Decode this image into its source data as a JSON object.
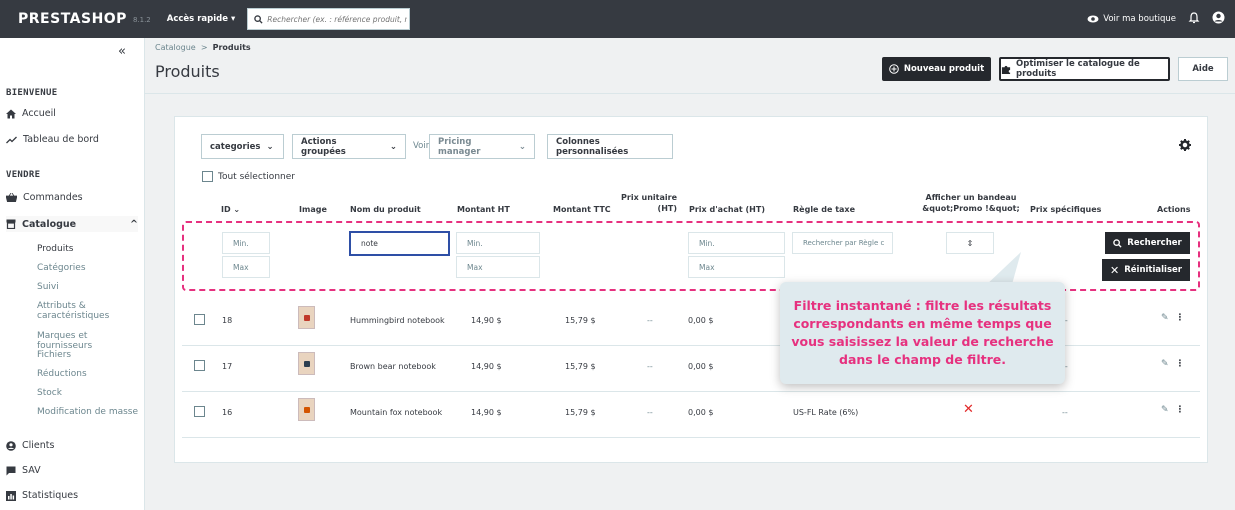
{
  "topbar": {
    "logo": "PRESTASHOP",
    "version": "8.1.2",
    "quick_access": "Accès rapide",
    "search_placeholder": "Rechercher (ex. : référence produit, no",
    "view_shop": "Voir ma boutique"
  },
  "sidebar": {
    "collapse": "«",
    "section_welcome": "BIENVENUE",
    "accueil": "Accueil",
    "dashboard": "Tableau de bord",
    "section_sell": "VENDRE",
    "commandes": "Commandes",
    "catalogue": "Catalogue",
    "sub": {
      "produits": "Produits",
      "categories": "Catégories",
      "suivi": "Suivi",
      "attributs_1": "Attributs &",
      "attributs_2": "caractéristiques",
      "marques": "Marques et fournisseurs",
      "fichiers": "Fichiers",
      "reductions": "Réductions",
      "stock": "Stock",
      "modif": "Modification de masse"
    },
    "clients": "Clients",
    "sav": "SAV",
    "stats": "Statistiques"
  },
  "header": {
    "breadcrumb_root": "Catalogue",
    "breadcrumb_sep": ">",
    "breadcrumb_current": "Produits",
    "title": "Produits",
    "new_product": "Nouveau produit",
    "optimize": "Optimiser le catalogue de produits",
    "help": "Aide"
  },
  "toolbar": {
    "categories": "categories",
    "bulk": "Actions groupées",
    "voir": "Voir",
    "pricing": "Pricing manager",
    "columns": "Colonnes personnalisées",
    "select_all": "Tout sélectionner"
  },
  "columns": {
    "id": "ID",
    "image": "Image",
    "name": "Nom du produit",
    "ht": "Montant HT",
    "ttc": "Montant TTC",
    "unit_1": "Prix unitaire",
    "unit_2": "(HT)",
    "purchase": "Prix d'achat (HT)",
    "tax": "Règle de taxe",
    "banner_1": "Afficher un bandeau",
    "banner_2": "&quot;Promo !&quot;",
    "specific": "Prix spécifiques",
    "actions": "Actions"
  },
  "filters": {
    "id_min": "Min.",
    "id_max": "Max",
    "name_value": "note",
    "ht_min": "Min.",
    "ht_max": "Max",
    "purchase_min": "Min.",
    "purchase_max": "Max",
    "tax_placeholder": "Rechercher par Règle c",
    "search": "Rechercher",
    "reset": "Réinitialiser"
  },
  "rows": [
    {
      "id": "18",
      "name": "Hummingbird notebook",
      "ht": "14,90 $",
      "ttc": "15,79 $",
      "unit": "--",
      "purchase": "0,00 $",
      "tax": "",
      "specific": "--",
      "thumb_color": "#c0392b"
    },
    {
      "id": "17",
      "name": "Brown bear notebook",
      "ht": "14,90 $",
      "ttc": "15,79 $",
      "unit": "--",
      "purchase": "0,00 $",
      "tax": "",
      "specific": "--",
      "thumb_color": "#2c3e50"
    },
    {
      "id": "16",
      "name": "Mountain fox notebook",
      "ht": "14,90 $",
      "ttc": "15,79 $",
      "unit": "--",
      "purchase": "0,00 $",
      "tax": "US-FL Rate (6%)",
      "specific": "--",
      "thumb_color": "#d35400"
    }
  ],
  "tooltip": {
    "line1": "Filtre instantané : filtre les résultats",
    "line2": "correspondants en même temps que",
    "line3": "vous saisissez la valeur de recherche",
    "line4": "dans le champ de filtre."
  },
  "colors": {
    "accent_pink": "#e6317f",
    "dark": "#25282d",
    "topbar": "#363a41"
  }
}
